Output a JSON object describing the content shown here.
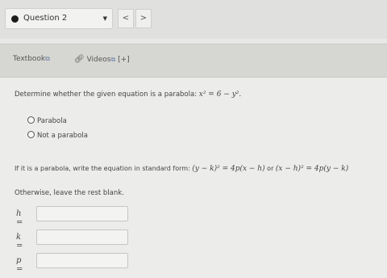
{
  "header": {
    "question_label": "Question 2",
    "prev_glyph": "<",
    "next_glyph": ">"
  },
  "resources": {
    "textbook": "Textbook",
    "videos": "Videos",
    "videos_suffix": "[+]",
    "ext_glyph": "⧉"
  },
  "problem": {
    "prompt_text": "Determine whether the given equation is a parabola:",
    "equation": "x² = 6 − y².",
    "options": [
      "Parabola",
      "Not a parabola"
    ],
    "instruction_text": "If it is a parabola, write the equation in standard form:",
    "form1": "(y − k)² = 4p(x − h)",
    "or_text": "or",
    "form2": "(x − h)² = 4p(y − k)",
    "otherwise_text": "Otherwise, leave the rest blank."
  },
  "fields": [
    {
      "label": "h =",
      "value": ""
    },
    {
      "label": "k =",
      "value": ""
    },
    {
      "label": "p =",
      "value": ""
    }
  ]
}
